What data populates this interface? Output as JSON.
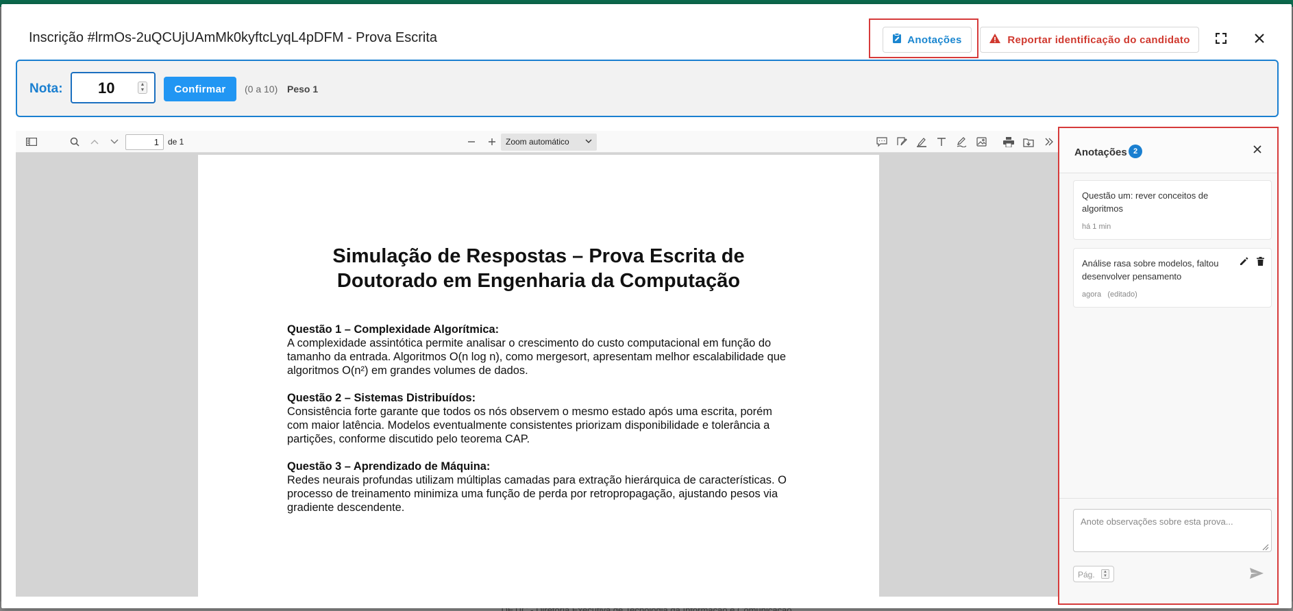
{
  "modal": {
    "title": "Inscrição #lrmOs-2uQCUjUAmMk0kyftcLyqL4pDFM - Prova Escrita",
    "annotations_button": "Anotações",
    "report_button": "Reportar identificação do candidato",
    "icons": {
      "annotations": "note-edit-icon",
      "report": "warning-icon",
      "fullscreen": "fullscreen-icon",
      "close": "close-icon"
    },
    "colors": {
      "accent": "#1a86d0",
      "danger": "#d0392f",
      "confirm": "#2196f3",
      "highlight": "#d63a3a"
    }
  },
  "grade": {
    "label": "Nota:",
    "value": "10",
    "confirm_label": "Confirmar",
    "range": "(0 a 10)",
    "weight": "Peso 1"
  },
  "viewer": {
    "page_current": "1",
    "page_total": "de 1",
    "zoom": "Zoom automático",
    "icons": [
      "sidebar-toggle-icon",
      "search-icon",
      "previous-page-icon",
      "next-page-icon",
      "zoom-out-icon",
      "zoom-in-icon",
      "comment-icon",
      "signature-icon",
      "highlight-icon",
      "text-icon",
      "draw-icon",
      "image-icon",
      "print-icon",
      "download-icon",
      "more-tools-icon"
    ]
  },
  "document": {
    "title": "Simulação de Respostas – Prova Escrita de Doutorado em Engenharia da Computação",
    "questions": [
      {
        "heading": "Questão 1 – Complexidade Algorítmica:",
        "text": "A complexidade assintótica permite analisar o crescimento do custo computacional em função do tamanho da entrada. Algoritmos O(n log n), como mergesort, apresentam melhor escalabilidade que algoritmos O(n²) em grandes volumes de dados."
      },
      {
        "heading": "Questão 2 – Sistemas Distribuídos:",
        "text": "Consistência forte garante que todos os nós observem o mesmo estado após uma escrita, porém com maior latência. Modelos eventualmente consistentes priorizam disponibilidade e tolerância a partições, conforme discutido pelo teorema CAP."
      },
      {
        "heading": "Questão 3 – Aprendizado de Máquina:",
        "text": "Redes neurais profundas utilizam múltiplas camadas para extração hierárquica de características. O processo de treinamento minimiza uma função de perda por retropropagação, ajustando pesos via gradiente descendente."
      }
    ]
  },
  "annotations_panel": {
    "title": "Anotações",
    "count": "2",
    "notes": [
      {
        "text": "Questão um: rever conceitos de algoritmos",
        "time": "há 1 min",
        "edited": ""
      },
      {
        "text": "Análise rasa sobre modelos, faltou desenvolver pensamento",
        "time": "agora",
        "edited": "(editado)"
      }
    ],
    "input_placeholder": "Anote observações sobre esta prova...",
    "page_placeholder": "Pág."
  },
  "footer_text": "DETIC - Diretoria Executiva de Tecnologia da Informação e Comunicação"
}
